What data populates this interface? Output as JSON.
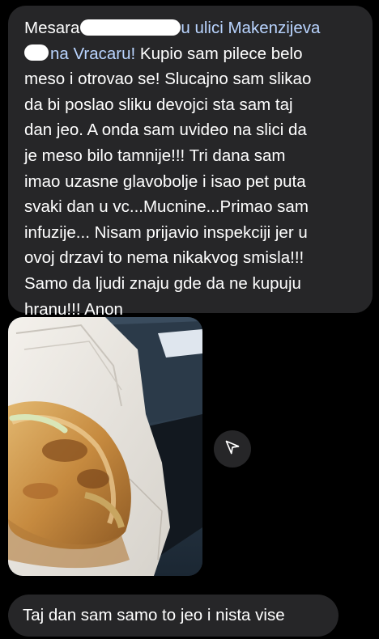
{
  "messages": {
    "first": {
      "part1": "Mesara",
      "part2": "u ulici Makenzijeva",
      "part3": "na Vracaru!",
      "rest": " Kupio sam pilece belo\nmeso i otrovao se! Slucajno sam slikao\nda bi poslao sliku devojci sta sam taj\ndan jeo. A onda sam uvideo na slici da\nje meso bilo tamnije!!! Tri dana sam\nimao uzasne glavobolje i isao pet puta\nsvaki dan u vc...Mucnine...Primao sam\ninfuzije... Nisam prijavio inspekciji jer u\novoj drzavi to nema nikakvog smisla!!!\nSamo da ljudi znaju gde da ne kupuju\nhranu!!! Anon"
    },
    "second": {
      "text": "Taj dan sam samo to jeo i nista vise"
    }
  },
  "icons": {
    "share": "paper-plane-icon"
  },
  "colors": {
    "background": "#000000",
    "bubble": "#262628",
    "text": "#ffffff",
    "link": "#b9d4ff"
  }
}
